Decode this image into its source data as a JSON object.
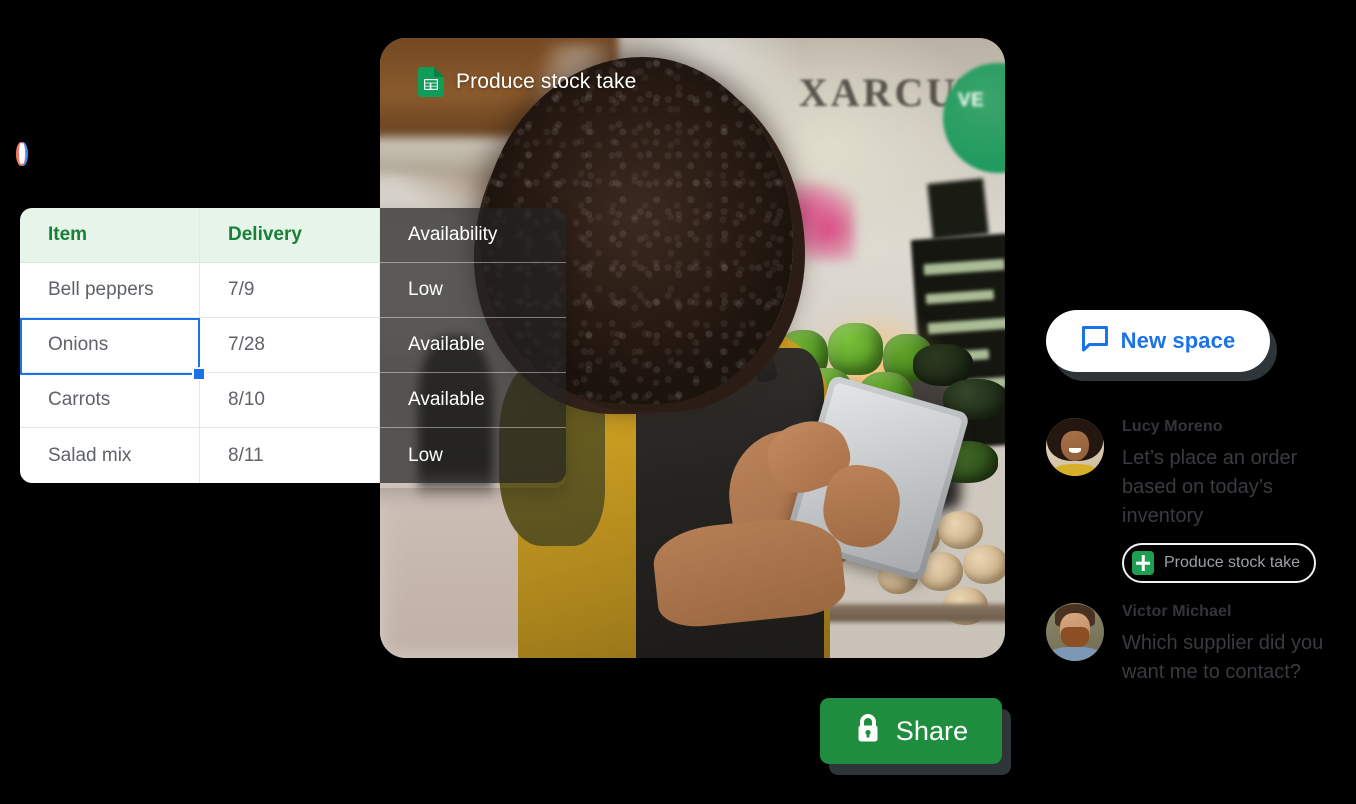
{
  "document": {
    "title": "Produce stock take",
    "title_icon": "google-sheets-icon"
  },
  "spreadsheet": {
    "columns": [
      "Item",
      "Delivery",
      "Availability"
    ],
    "rows": [
      {
        "item": "Bell peppers",
        "delivery": "7/9",
        "availability": "Low"
      },
      {
        "item": "Onions",
        "delivery": "7/28",
        "availability": "Available"
      },
      {
        "item": "Carrots",
        "delivery": "8/10",
        "availability": "Available"
      },
      {
        "item": "Salad mix",
        "delivery": "8/11",
        "availability": "Low"
      }
    ],
    "selected_cell": "Onions",
    "header_bg": "#e6f4ea",
    "header_text_color": "#188038",
    "selection_color": "#1a73e8",
    "overlay_column_bg": "rgba(35,35,35,0.70)"
  },
  "collaborators": [
    {
      "ring_color": "#4285f4",
      "name_icon": "avatar"
    },
    {
      "ring_color": "#ee7a6a",
      "name_icon": "avatar"
    }
  ],
  "chat": {
    "new_space_button": {
      "label": "New space",
      "icon": "chat-bubble-icon",
      "text_color": "#1a73e8"
    },
    "messages": [
      {
        "author": "Lucy Moreno",
        "text": "Let’s place an order based on today’s inventory",
        "attachment": {
          "label": "Produce stock take",
          "icon": "google-sheets-icon"
        }
      },
      {
        "author": "Victor Michael",
        "text": "Which supplier did you want me to contact?",
        "attachment": null
      }
    ]
  },
  "share_button": {
    "label": "Share",
    "icon": "lock-icon",
    "bg_color": "#1e8e3e",
    "text_color": "#ffffff"
  },
  "photo": {
    "alt": "grocer-with-tablet-in-produce-market",
    "background_sign_text": "XARCUTER",
    "circle_sign_text": "VE"
  }
}
